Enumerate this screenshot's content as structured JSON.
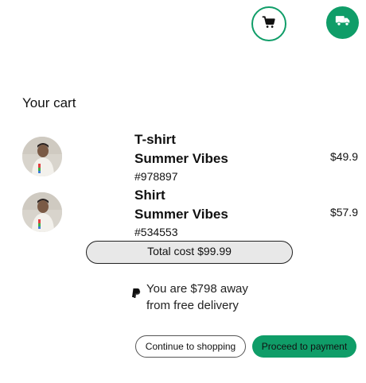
{
  "header": {
    "cart_icon": "cart-icon",
    "truck_icon": "truck-icon"
  },
  "cart": {
    "heading": "Your cart",
    "items": [
      {
        "name": "T-shirt",
        "subtitle": "Summer Vibes",
        "sku": "#978897",
        "price": "$49.9",
        "thumbnail": "product-photo"
      },
      {
        "name": "Shirt",
        "subtitle": "Summer Vibes",
        "sku": "#534553",
        "price": "$57.9",
        "thumbnail": "product-photo"
      }
    ],
    "total": "Total cost $99.99"
  },
  "delivery": {
    "icon": "paypal-icon",
    "message": "You are $798 away from free delivery"
  },
  "actions": {
    "continue_label": "Continue to shopping",
    "proceed_label": "Proceed to payment"
  },
  "colors": {
    "accent": "#0f9d68",
    "total_bg": "#e8e8e8"
  }
}
